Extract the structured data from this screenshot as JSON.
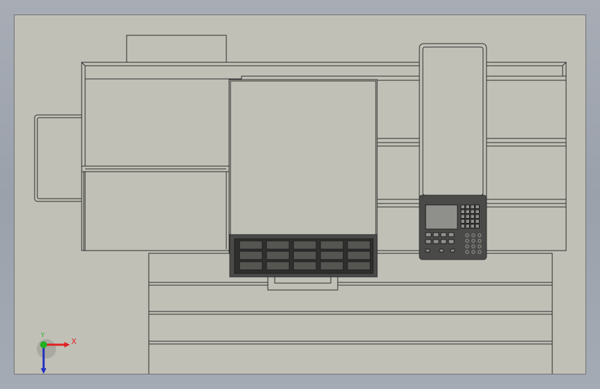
{
  "viewport": {
    "background": "#c1c0b7",
    "edge_color": "#2b2b2b",
    "face_color": "#c1c0b7",
    "panel_color": "#4a4a48",
    "screen_color": "#8f8f8b"
  },
  "triad": {
    "x_label": "X",
    "y_label": "Y",
    "x_color": "#e02020",
    "y_color": "#20b020",
    "z_color": "#2030c0"
  }
}
